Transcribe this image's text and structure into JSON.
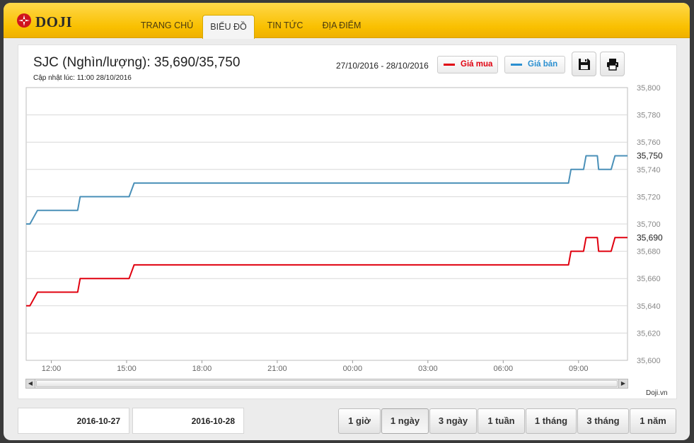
{
  "brand": {
    "name": "DOJI"
  },
  "nav": {
    "items": [
      {
        "label": "TRANG CHỦ"
      },
      {
        "label": "BIỂU ĐỒ"
      },
      {
        "label": "TIN TỨC"
      },
      {
        "label": "ĐỊA ĐIỂM"
      }
    ]
  },
  "header": {
    "title": "SJC (Nghìn/lượng): 35,690/35,750",
    "updated": "Cập nhật lúc: 11:00 28/10/2016",
    "date_range": "27/10/2016 - 28/10/2016"
  },
  "legend": {
    "buy": {
      "label": "Giá mua",
      "color": "#e0000f"
    },
    "sell": {
      "label": "Giá bán",
      "color": "#4a90b8"
    }
  },
  "toolbar": {
    "save_icon": "save-icon",
    "print_icon": "print-icon"
  },
  "watermark": "Doji.vn",
  "dates": {
    "from": "2016-10-27",
    "to": "2016-10-28"
  },
  "periods": [
    {
      "label": "1 giờ"
    },
    {
      "label": "1 ngày"
    },
    {
      "label": "3 ngày"
    },
    {
      "label": "1 tuần"
    },
    {
      "label": "1 tháng"
    },
    {
      "label": "3 tháng"
    },
    {
      "label": "1 năm"
    }
  ],
  "chart_data": {
    "type": "line",
    "ylim": [
      35600,
      35800
    ],
    "y_ticks": [
      "35,600",
      "35,620",
      "35,640",
      "35,660",
      "35,680",
      "35,700",
      "35,720",
      "35,740",
      "35,760",
      "35,780",
      "35,800"
    ],
    "x_ticks": [
      "12:00",
      "15:00",
      "18:00",
      "21:00",
      "00:00",
      "03:00",
      "06:00",
      "09:00"
    ],
    "x_unit": "hours since 00:00 27/10/2016",
    "x_tick_values": [
      12,
      15,
      18,
      21,
      24,
      27,
      30,
      33
    ],
    "xlim": [
      11.0,
      34.95
    ],
    "grid": true,
    "last_labels": [
      "35,750",
      "35,690"
    ],
    "series": [
      {
        "name": "Giá bán",
        "color": "#4a90b8",
        "points": [
          [
            11.0,
            35700
          ],
          [
            11.15,
            35700
          ],
          [
            11.45,
            35710
          ],
          [
            13.05,
            35710
          ],
          [
            13.15,
            35720
          ],
          [
            15.1,
            35720
          ],
          [
            15.3,
            35730
          ],
          [
            32.6,
            35730
          ],
          [
            32.7,
            35740
          ],
          [
            33.2,
            35740
          ],
          [
            33.3,
            35750
          ],
          [
            33.75,
            35750
          ],
          [
            33.8,
            35740
          ],
          [
            34.3,
            35740
          ],
          [
            34.45,
            35750
          ],
          [
            34.95,
            35750
          ]
        ]
      },
      {
        "name": "Giá mua",
        "color": "#e0000f",
        "points": [
          [
            11.0,
            35640
          ],
          [
            11.15,
            35640
          ],
          [
            11.45,
            35650
          ],
          [
            13.05,
            35650
          ],
          [
            13.15,
            35660
          ],
          [
            15.1,
            35660
          ],
          [
            15.3,
            35670
          ],
          [
            32.6,
            35670
          ],
          [
            32.7,
            35680
          ],
          [
            33.2,
            35680
          ],
          [
            33.3,
            35690
          ],
          [
            33.75,
            35690
          ],
          [
            33.8,
            35680
          ],
          [
            34.3,
            35680
          ],
          [
            34.45,
            35690
          ],
          [
            34.95,
            35690
          ]
        ]
      }
    ]
  }
}
